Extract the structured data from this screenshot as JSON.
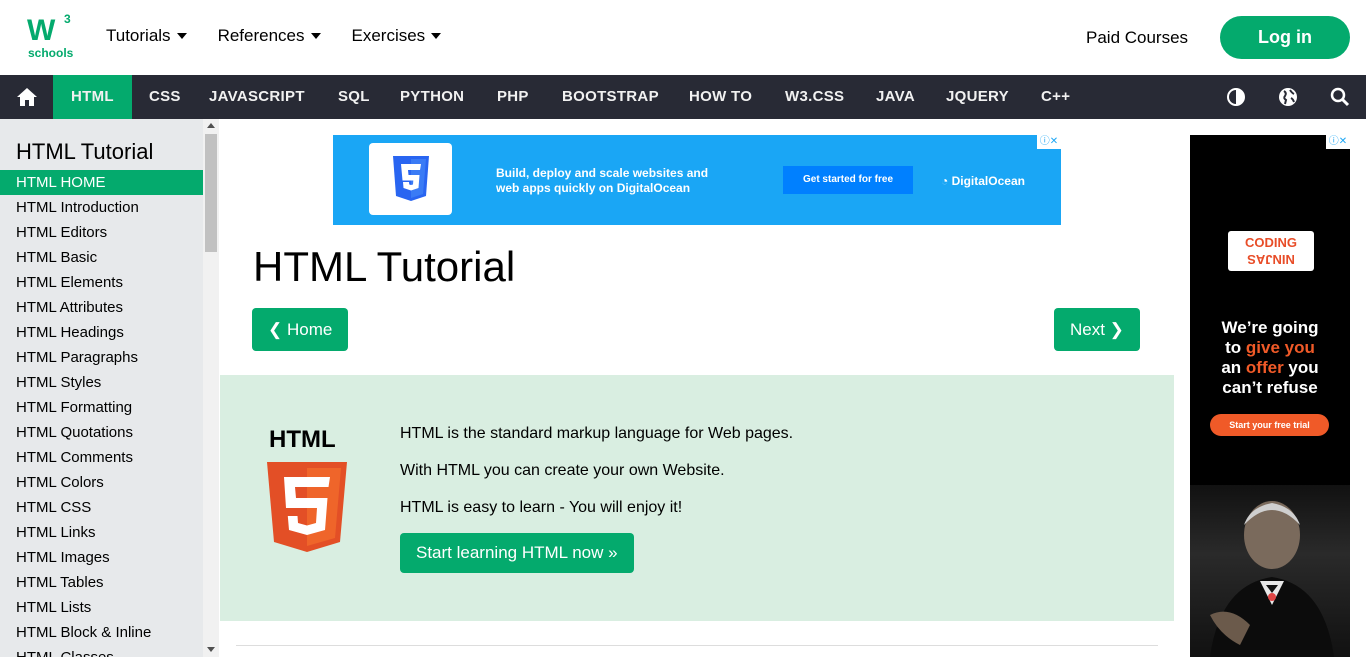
{
  "header": {
    "logo_text": "W",
    "logo_sup": "3",
    "logo_sub": "schools",
    "nav": [
      {
        "label": "Tutorials"
      },
      {
        "label": "References"
      },
      {
        "label": "Exercises"
      }
    ],
    "paid_courses": "Paid Courses",
    "login": "Log in"
  },
  "topnav": {
    "links": [
      "HTML",
      "CSS",
      "JAVASCRIPT",
      "SQL",
      "PYTHON",
      "PHP",
      "BOOTSTRAP",
      "HOW TO",
      "W3.CSS",
      "JAVA",
      "JQUERY",
      "C++"
    ],
    "active": "HTML"
  },
  "sidebar": {
    "title": "HTML Tutorial",
    "items": [
      "HTML HOME",
      "HTML Introduction",
      "HTML Editors",
      "HTML Basic",
      "HTML Elements",
      "HTML Attributes",
      "HTML Headings",
      "HTML Paragraphs",
      "HTML Styles",
      "HTML Formatting",
      "HTML Quotations",
      "HTML Comments",
      "HTML Colors",
      "HTML CSS",
      "HTML Links",
      "HTML Images",
      "HTML Tables",
      "HTML Lists",
      "HTML Block & Inline",
      "HTML Classes"
    ]
  },
  "ad_top": {
    "text_line1": "Build, deploy and scale websites and",
    "text_line2": "web apps quickly on DigitalOcean",
    "button": "Get started for free",
    "brand": "DigitalOcean"
  },
  "main": {
    "title": "HTML Tutorial",
    "prev_button": "❮ Home",
    "next_button": "Next ❯",
    "intro": {
      "label": "HTML",
      "lines": [
        "HTML is the standard markup language for Web pages.",
        "With HTML you can create your own Website.",
        "HTML is easy to learn - You will enjoy it!"
      ],
      "cta": "Start learning HTML now »"
    }
  },
  "ad_right": {
    "brand_line1": "CODING",
    "brand_line2": "NINJAS",
    "tag_line1": "We’re going",
    "tag_line2a": "to ",
    "tag_line2b": "give you",
    "tag_line3a": "an ",
    "tag_line3b": "offer",
    "tag_line3c": " you",
    "tag_line4": "can’t refuse",
    "cta": "Start your free trial"
  },
  "colors": {
    "accent": "#04AA6D",
    "dark_nav": "#282A35",
    "sidebar": "#E7E9EB",
    "intro_bg": "#D9EEE1",
    "ad_orange": "#f05a28"
  }
}
